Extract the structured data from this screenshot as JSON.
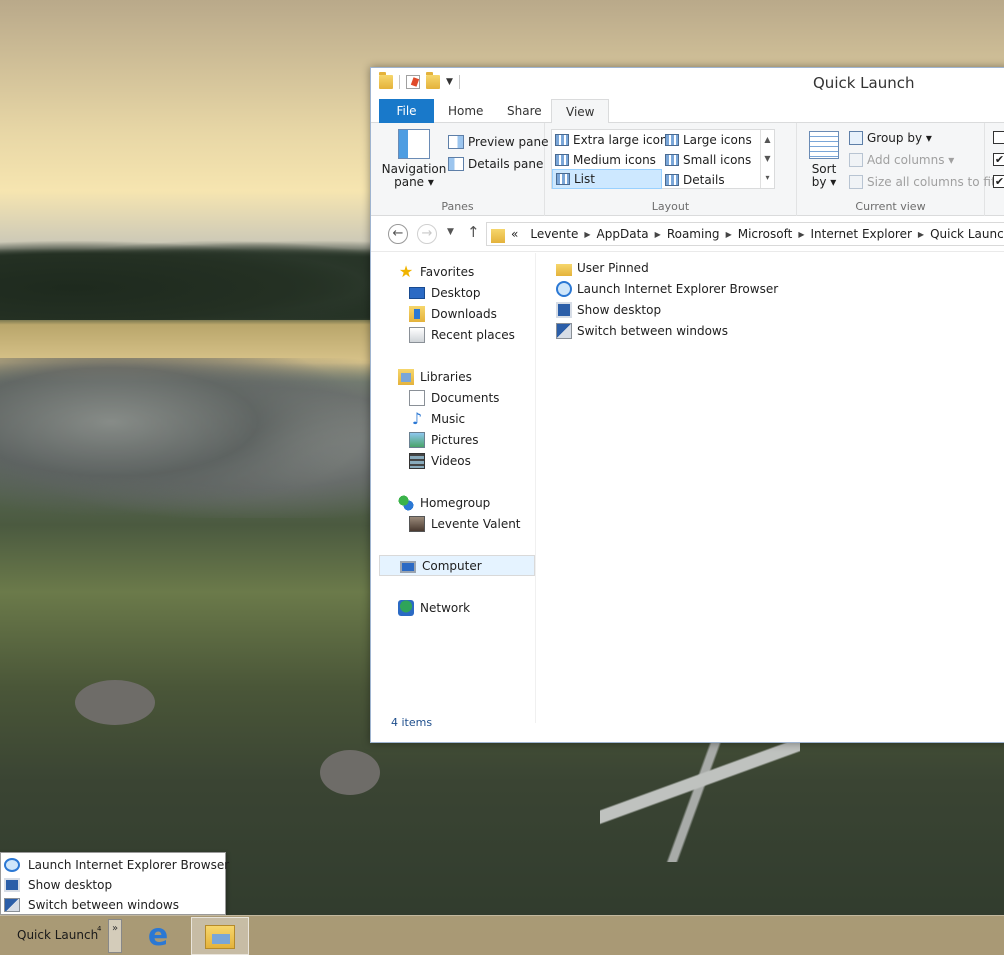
{
  "window": {
    "title": "Quick Launch",
    "tabs": {
      "file": "File",
      "home": "Home",
      "share": "Share",
      "view": "View"
    }
  },
  "ribbon": {
    "panes": {
      "navigation_pane_line1": "Navigation",
      "navigation_pane_line2": "pane ▾",
      "preview_pane": "Preview pane",
      "details_pane": "Details pane",
      "label": "Panes"
    },
    "layout": {
      "items": [
        "Extra large icons",
        "Large icons",
        "Medium icons",
        "Small icons",
        "List",
        "Details"
      ],
      "selected": "List",
      "label": "Layout"
    },
    "current_view": {
      "sort_by_line1": "Sort",
      "sort_by_line2": "by ▾",
      "group_by": "Group by ▾",
      "add_columns": "Add columns ▾",
      "size_all_columns": "Size all columns to fit",
      "label": "Current view"
    },
    "checkbox_marks": [
      "",
      "✔",
      "✔"
    ]
  },
  "address": {
    "overflow": "«",
    "crumbs": [
      "Levente",
      "AppData",
      "Roaming",
      "Microsoft",
      "Internet Explorer",
      "Quick Launch"
    ]
  },
  "nav": {
    "favorites": "Favorites",
    "desktop": "Desktop",
    "downloads": "Downloads",
    "recent_places": "Recent places",
    "libraries": "Libraries",
    "documents": "Documents",
    "music": "Music",
    "pictures": "Pictures",
    "videos": "Videos",
    "homegroup": "Homegroup",
    "user": "Levente Valent",
    "computer": "Computer",
    "network": "Network"
  },
  "files": [
    {
      "name": "User Pinned",
      "icon": "folder-icon"
    },
    {
      "name": "Launch Internet Explorer Browser",
      "icon": "internet-explorer-icon"
    },
    {
      "name": "Show desktop",
      "icon": "show-desktop-icon"
    },
    {
      "name": "Switch between windows",
      "icon": "switch-windows-icon"
    }
  ],
  "status": {
    "item_count": "4 items"
  },
  "popup_menu": {
    "items": [
      "Launch Internet Explorer Browser",
      "Show desktop",
      "Switch between windows"
    ]
  },
  "taskbar": {
    "toolbar_label": "Quick Launch",
    "toolbar_chevron": "⁴",
    "more_button": "»",
    "ie_glyph": "e"
  },
  "colors": {
    "file_tab": "#1979ca",
    "selection": "#cde8ff",
    "link_text": "#1e4e8c"
  }
}
